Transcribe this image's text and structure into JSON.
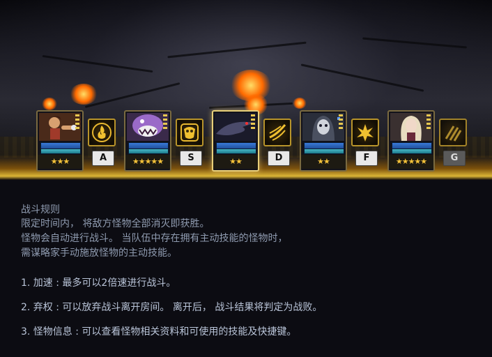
{
  "team": [
    {
      "portrait_icon": "fighter-girl-portrait",
      "stars": "★★★",
      "skill_icon": "flame-emblem-icon",
      "hotkey": "A",
      "active": false
    },
    {
      "portrait_icon": "purple-fanged-monster-portrait",
      "stars": "★★★★★",
      "skill_icon": "mask-emblem-icon",
      "hotkey": "S",
      "active": false
    },
    {
      "portrait_icon": "shadow-dragon-portrait",
      "stars": "★★",
      "skill_icon": "wind-slash-icon",
      "hotkey": "D",
      "active": true
    },
    {
      "portrait_icon": "hooded-reaper-portrait",
      "stars": "★★",
      "skill_icon": "fire-burst-icon",
      "hotkey": "F",
      "active": false
    },
    {
      "portrait_icon": "blonde-sorceress-portrait",
      "stars": "★★★★★",
      "skill_icon": "claw-strike-icon",
      "hotkey": "G",
      "active": false
    }
  ],
  "rules": {
    "title": "战斗规则",
    "lines": [
      "限定时间内， 将敌方怪物全部消灭即获胜。",
      "怪物会自动进行战斗。 当队伍中存在拥有主动技能的怪物时，",
      "需谋略家手动施放怪物的主动技能。"
    ],
    "items": [
      "1. 加速 : 最多可以2倍速进行战斗。",
      "2. 弃权 : 可以放弃战斗离开房间。 离开后， 战斗结果将判定为战败。",
      "3. 怪物信息 : 可以查看怪物相关资料和可使用的技能及快捷键。"
    ]
  },
  "colors": {
    "rules_text": "#8f9bb0",
    "item_text": "#b9c4d8",
    "gold": "#b8942a",
    "star": "#f4c23a"
  }
}
